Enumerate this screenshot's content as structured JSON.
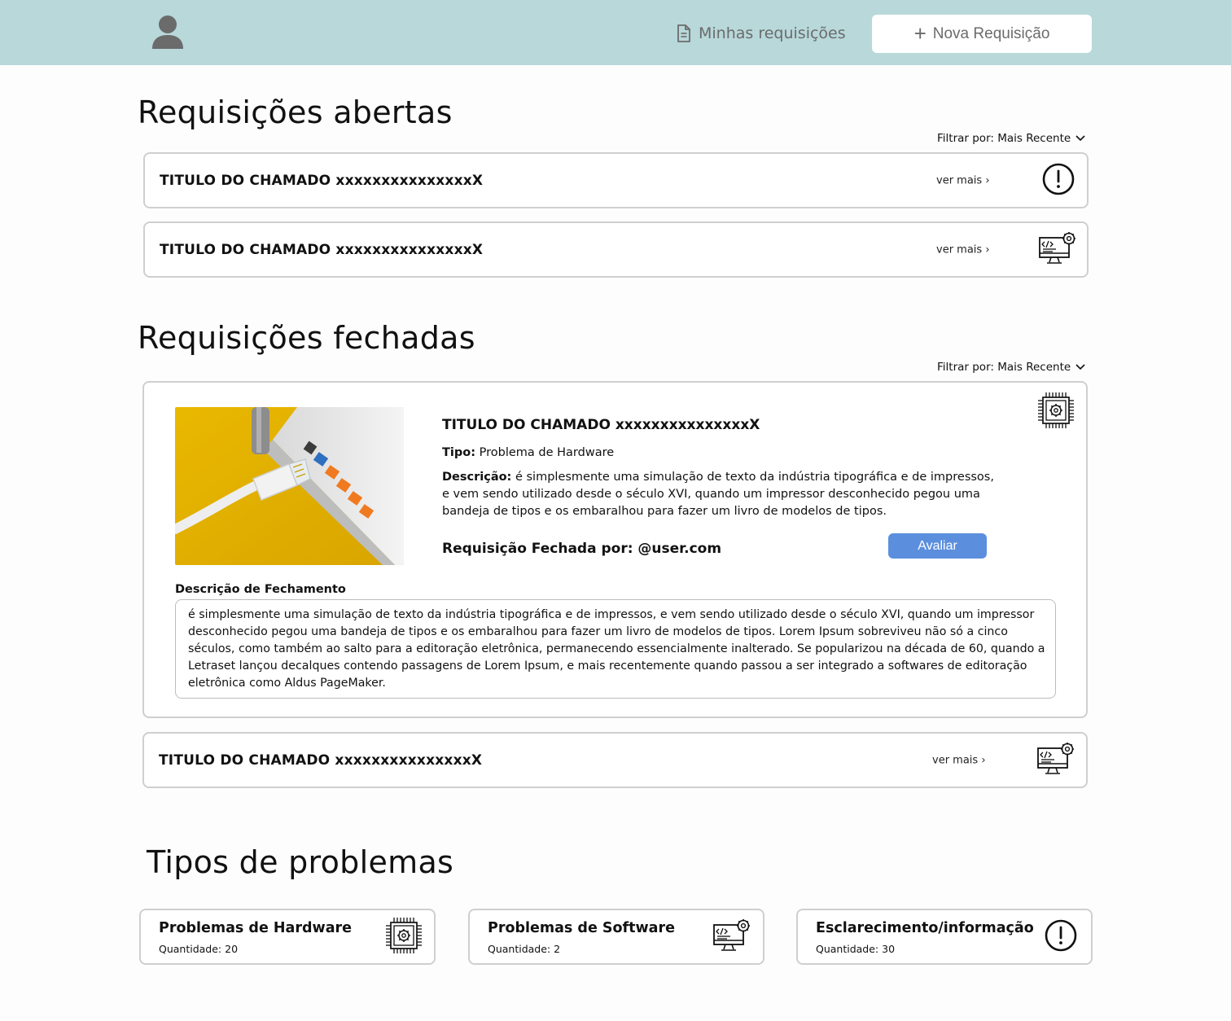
{
  "header": {
    "my_requests_label": "Minhas requisições",
    "new_request_label": "Nova Requisição",
    "background_color": "#b8d8da"
  },
  "open_section": {
    "title": "Requisições abertas",
    "filter_label": "Filtrar por: Mais Recente",
    "tickets": [
      {
        "title": "TITULO DO CHAMADO xxxxxxxxxxxxxxxX",
        "more": "ver mais ›",
        "icon": "exclamation-icon"
      },
      {
        "title": "TITULO DO CHAMADO xxxxxxxxxxxxxxxX",
        "more": "ver mais ›",
        "icon": "software-monitor-icon"
      }
    ]
  },
  "closed_section": {
    "title": "Requisições fechadas",
    "filter_label": "Filtrar por: Mais Recente",
    "expanded": {
      "title": "TITULO DO CHAMADO xxxxxxxxxxxxxxxX",
      "tipo_label": "Tipo:",
      "tipo_value": "Problema de Hardware",
      "desc_label": "Descrição:",
      "desc_value": "é simplesmente uma simulação de texto da indústria tipográfica e de impressos, e vem sendo utilizado desde o século XVI, quando um impressor desconhecido pegou uma bandeja de tipos e os embaralhou para fazer um livro de modelos de tipos.",
      "closed_by": "Requisição Fechada por: @user.com",
      "rate_label": "Avaliar",
      "rate_color": "#5b8fde",
      "closing_label": "Descrição de Fechamento",
      "closing_text": "é simplesmente uma simulação de texto da indústria tipográfica e de impressos, e vem sendo utilizado desde o século XVI, quando um impressor desconhecido pegou uma bandeja de tipos e os embaralhou para fazer um livro de modelos de tipos. Lorem Ipsum sobreviveu não só a cinco séculos, como também ao salto para a editoração eletrônica, permanecendo essencialmente inalterado. Se popularizou na década de 60, quando a Letraset lançou decalques contendo passagens de Lorem Ipsum, e mais recentemente quando passou a ser integrado a softwares de editoração eletrônica como Aldus PageMaker.",
      "icon": "hardware-chip-icon"
    },
    "tickets": [
      {
        "title": "TITULO DO CHAMADO xxxxxxxxxxxxxxxX",
        "more": "ver mais ›",
        "icon": "software-monitor-icon"
      }
    ]
  },
  "types_section": {
    "title": "Tipos de problemas",
    "cards": [
      {
        "title": "Problemas de Hardware",
        "quantity": "Quantidade: 20",
        "icon": "hardware-chip-icon"
      },
      {
        "title": "Problemas de Software",
        "quantity": "Quantidade: 2",
        "icon": "software-monitor-icon"
      },
      {
        "title": "Esclarecimento/informação",
        "quantity": "Quantidade: 30",
        "icon": "exclamation-icon"
      }
    ]
  }
}
